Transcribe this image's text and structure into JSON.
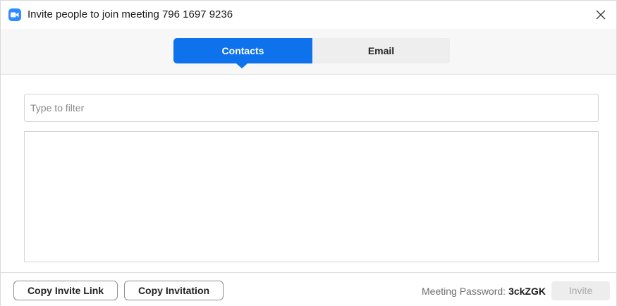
{
  "window": {
    "title": "Invite people to join meeting 796 1697 9236",
    "icon": "zoom-app-icon",
    "close_icon": "close-icon"
  },
  "tabs": {
    "items": [
      {
        "label": "Contacts",
        "selected": true
      },
      {
        "label": "Email",
        "selected": false
      }
    ]
  },
  "filter": {
    "placeholder": "Type to filter",
    "value": ""
  },
  "contacts": {
    "items": []
  },
  "footer": {
    "copy_invite_link_label": "Copy Invite Link",
    "copy_invitation_label": "Copy Invitation",
    "password_label": "Meeting Password:",
    "password_value": "3ckZGK",
    "invite_label": "Invite",
    "invite_enabled": false
  },
  "colors": {
    "accent": "#0e72ed",
    "icon_blue": "#2d8cff",
    "disabled_bg": "#ededed",
    "disabled_text": "#a8a8a8"
  }
}
